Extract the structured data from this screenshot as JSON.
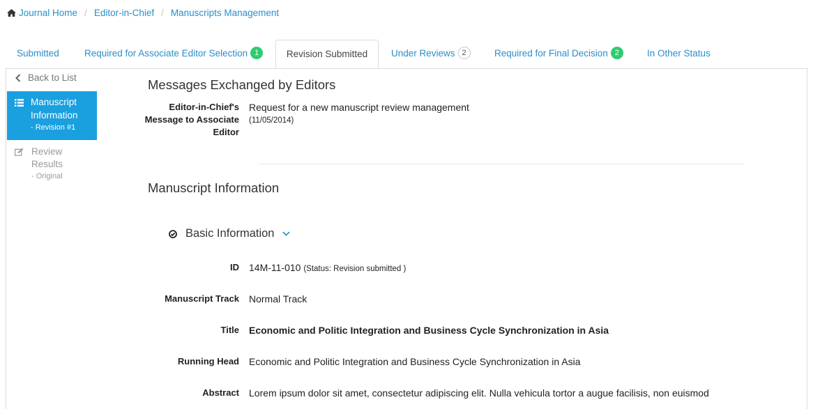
{
  "breadcrumb": {
    "home": "Journal Home",
    "editor": "Editor-in-Chief",
    "current": "Manuscripts Management"
  },
  "tabs": [
    {
      "label": "Submitted",
      "badge": ""
    },
    {
      "label": "Required for Associate Editor Selection",
      "badge": "1"
    },
    {
      "label": "Revision Submitted",
      "badge": ""
    },
    {
      "label": "Under Reviews",
      "badge": "2"
    },
    {
      "label": "Required for Final Decision",
      "badge": "2"
    },
    {
      "label": "In Other Status",
      "badge": ""
    }
  ],
  "sidebar": {
    "back": "Back to List",
    "items": [
      {
        "label": "Manuscript Information",
        "sub": "- Revision #1"
      },
      {
        "label": "Review Results",
        "sub": "- Original"
      }
    ]
  },
  "messages": {
    "title": "Messages Exchanged by Editors",
    "label": "Editor-in-Chief's Message to Associate Editor",
    "text": "Request for a new manuscript review management",
    "date": "(11/05/2014)"
  },
  "manuscript": {
    "title": "Manuscript Information",
    "section": "Basic Information",
    "fields": {
      "id_label": "ID",
      "id_value": "14M-11-010",
      "id_status": "(Status: Revision submitted )",
      "track_label": "Manuscript Track",
      "track_value": "Normal Track",
      "title_label": "Title",
      "title_value": "Economic and Politic Integration and Business Cycle Synchronization in Asia",
      "running_label": "Running Head",
      "running_value": "Economic and Politic Integration and Business Cycle Synchronization in Asia",
      "abstract_label": "Abstract",
      "abstract_value": "Lorem ipsum dolor sit amet, consectetur adipiscing elit. Nulla vehicula tortor a augue facilisis, non euismod"
    }
  },
  "colors": {
    "link": "#2a8fc7",
    "active": "#1a9fdf",
    "badge": "#2ecc71"
  }
}
